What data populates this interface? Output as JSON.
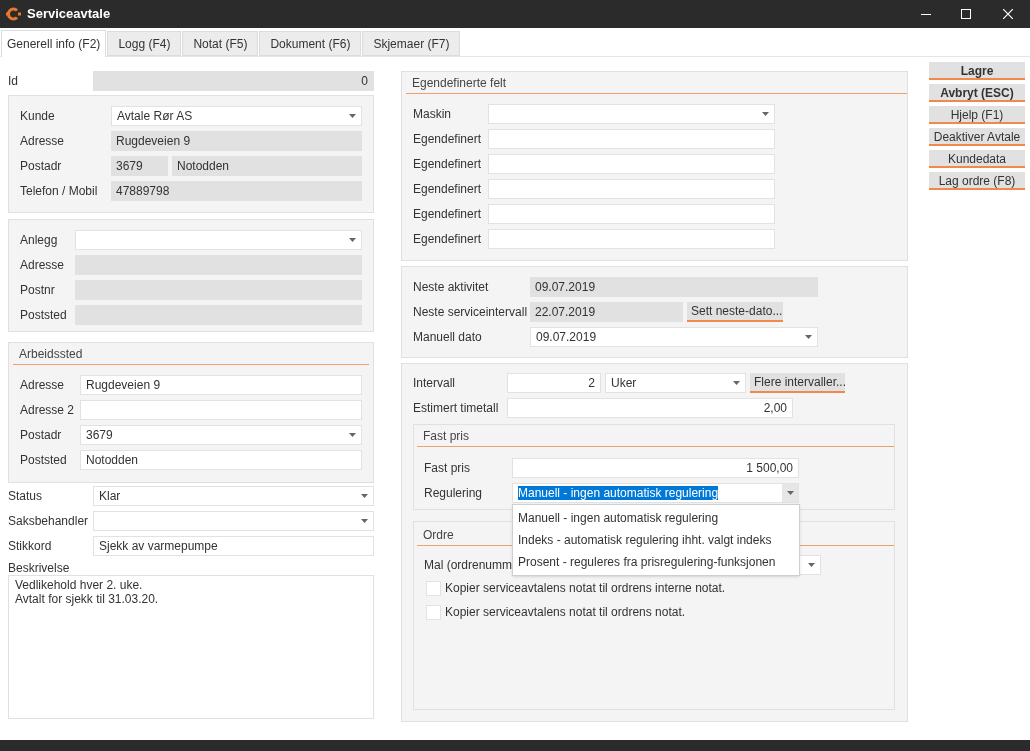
{
  "window": {
    "title": "Serviceavtale"
  },
  "tabs": [
    {
      "label": "Generell info (F2)",
      "selected": true
    },
    {
      "label": "Logg (F4)",
      "selected": false
    },
    {
      "label": "Notat (F5)",
      "selected": false
    },
    {
      "label": "Dokument (F6)",
      "selected": false
    },
    {
      "label": "Skjemaer (F7)",
      "selected": false
    }
  ],
  "id": {
    "label": "Id",
    "value": "0"
  },
  "customer": [
    {
      "label": "Kunde",
      "controls": [
        {
          "kind": "select",
          "value": "Avtale Rør AS"
        }
      ]
    },
    {
      "label": "Adresse",
      "controls": [
        {
          "kind": "readonly",
          "value": "Rugdeveien 9"
        }
      ]
    },
    {
      "label": "Postadr",
      "controls": [
        {
          "kind": "readonly",
          "value": "3679"
        },
        {
          "kind": "readonly",
          "value": "Notodden"
        }
      ]
    },
    {
      "label": "Telefon / Mobil",
      "controls": [
        {
          "kind": "readonly",
          "value": "47889798"
        }
      ]
    }
  ],
  "facility": [
    {
      "label": "Anlegg",
      "controls": [
        {
          "kind": "select"
        }
      ]
    },
    {
      "label": "Adresse",
      "controls": [
        {
          "kind": "readonly"
        }
      ]
    },
    {
      "label": "Postnr",
      "controls": [
        {
          "kind": "readonly"
        }
      ]
    },
    {
      "label": "Poststed",
      "controls": [
        {
          "kind": "readonly"
        }
      ]
    }
  ],
  "worksite": {
    "title": "Arbeidssted",
    "rows": [
      {
        "label": "Adresse",
        "controls": [
          {
            "kind": "text",
            "value": "Rugdeveien 9"
          }
        ]
      },
      {
        "label": "Adresse 2",
        "controls": [
          {
            "kind": "text"
          }
        ]
      },
      {
        "label": "Postadr",
        "controls": [
          {
            "kind": "select",
            "value": "3679"
          }
        ]
      },
      {
        "label": "Poststed",
        "controls": [
          {
            "kind": "text",
            "value": "Notodden"
          }
        ]
      }
    ]
  },
  "details": [
    {
      "label": "Status",
      "controls": [
        {
          "kind": "select",
          "value": "Klar"
        }
      ]
    },
    {
      "label": "Saksbehandler",
      "controls": [
        {
          "kind": "select"
        }
      ]
    },
    {
      "label": "Stikkord",
      "controls": [
        {
          "kind": "text",
          "value": "Sjekk av varmepumpe"
        }
      ]
    }
  ],
  "description": {
    "label": "Beskrivelse",
    "lines": [
      "Vedlikehold hver 2. uke.",
      "Avtalt for sjekk til 31.03.20."
    ]
  },
  "custom_fields": {
    "title": "Egendefinerte felt",
    "rows": [
      {
        "label": "Maskin",
        "controls": [
          {
            "kind": "select"
          }
        ]
      },
      {
        "label": "Egendefinert",
        "controls": [
          {
            "kind": "text"
          }
        ]
      },
      {
        "label": "Egendefinert",
        "controls": [
          {
            "kind": "text"
          }
        ]
      },
      {
        "label": "Egendefinert",
        "controls": [
          {
            "kind": "text"
          }
        ]
      },
      {
        "label": "Egendefinert",
        "controls": [
          {
            "kind": "text"
          }
        ]
      },
      {
        "label": "Egendefinert",
        "controls": [
          {
            "kind": "text"
          }
        ]
      }
    ]
  },
  "schedule": [
    {
      "label": "Neste aktivitet",
      "controls": [
        {
          "kind": "readonly",
          "value": "09.07.2019"
        }
      ]
    },
    {
      "label": "Neste serviceintervall",
      "controls": [
        {
          "kind": "readonly",
          "value": "22.07.2019"
        },
        {
          "kind": "button",
          "value": "Sett neste-dato..."
        }
      ]
    },
    {
      "label": "Manuell dato",
      "controls": [
        {
          "kind": "select",
          "value": "09.07.2019"
        }
      ]
    }
  ],
  "interval": [
    {
      "label": "Intervall",
      "controls": [
        {
          "kind": "number",
          "value": "2"
        },
        {
          "kind": "select",
          "value": "Uker"
        },
        {
          "kind": "button",
          "value": "Flere intervaller..."
        }
      ]
    },
    {
      "label": "Estimert timetall",
      "controls": [
        {
          "kind": "number",
          "value": "2,00"
        }
      ]
    }
  ],
  "fixed_price": {
    "title": "Fast pris",
    "price": {
      "label": "Fast pris",
      "value": "1 500,00"
    },
    "regulation": {
      "label": "Regulering",
      "value": "Manuell - ingen automatisk regulering",
      "expanded": true,
      "options": [
        "Manuell - ingen automatisk regulering",
        "Indeks - automatisk regulering ihht. valgt indeks",
        "Prosent - reguleres fra prisregulering-funksjonen"
      ]
    }
  },
  "order": {
    "title": "Ordre",
    "template_label": "Mal (ordrenumm",
    "checkboxes": [
      {
        "label": "Kopier serviceavtalens notat til ordrens interne notat.",
        "checked": false
      },
      {
        "label": "Kopier serviceavtalens notat til ordrens notat.",
        "checked": false
      }
    ]
  },
  "actions": [
    {
      "label": "Lagre",
      "bold": true
    },
    {
      "label": "Avbryt (ESC)",
      "bold": true
    },
    {
      "label": "Hjelp (F1)",
      "bold": false
    },
    {
      "label": "Deaktiver Avtale",
      "bold": false
    },
    {
      "label": "Kundedata",
      "bold": false
    },
    {
      "label": "Lag ordre (F8)",
      "bold": false
    }
  ]
}
